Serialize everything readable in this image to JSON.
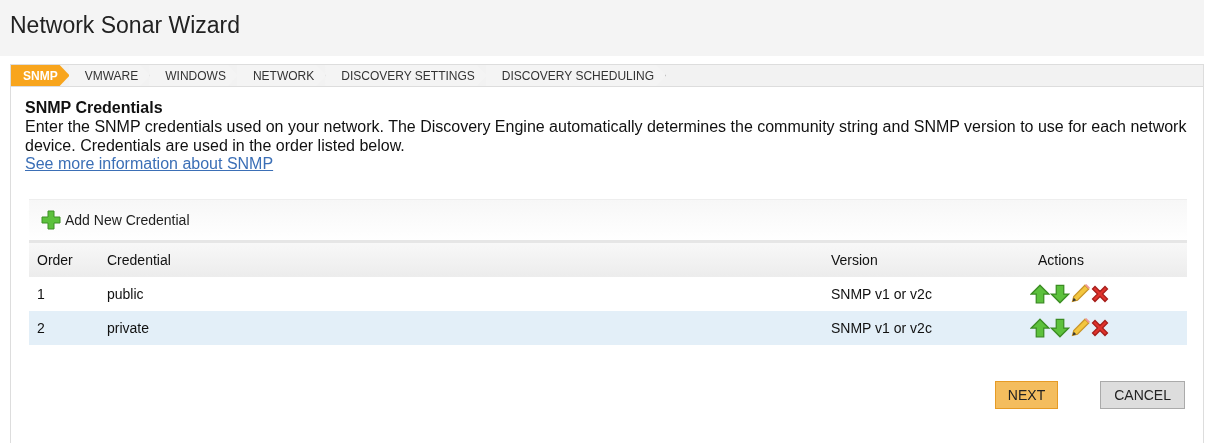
{
  "window": {
    "title": "Network Sonar Wizard"
  },
  "steps": [
    {
      "label": "SNMP",
      "selected": true
    },
    {
      "label": "VMWARE",
      "selected": false
    },
    {
      "label": "WINDOWS",
      "selected": false
    },
    {
      "label": "NETWORK",
      "selected": false
    },
    {
      "label": "DISCOVERY SETTINGS",
      "selected": false
    },
    {
      "label": "DISCOVERY SCHEDULING",
      "selected": false
    }
  ],
  "section": {
    "heading": "SNMP Credentials",
    "description": "Enter the SNMP credentials used on your network. The Discovery Engine automatically determines the community string and SNMP version to use for each network device. Credentials are used in the order listed below.",
    "link": "See more information about SNMP"
  },
  "toolbar": {
    "add_button": "Add New Credential"
  },
  "table": {
    "columns": [
      "Order",
      "Credential",
      "Version",
      "Actions"
    ],
    "rows": [
      {
        "order": "1",
        "credential": "public",
        "version": "SNMP v1 or v2c",
        "selected": false
      },
      {
        "order": "2",
        "credential": "private",
        "version": "SNMP v1 or v2c",
        "selected": true
      }
    ]
  },
  "buttons": [
    {
      "label": "NEXT",
      "kind": "primary"
    },
    {
      "label": "CANCEL",
      "kind": "secondary"
    }
  ]
}
